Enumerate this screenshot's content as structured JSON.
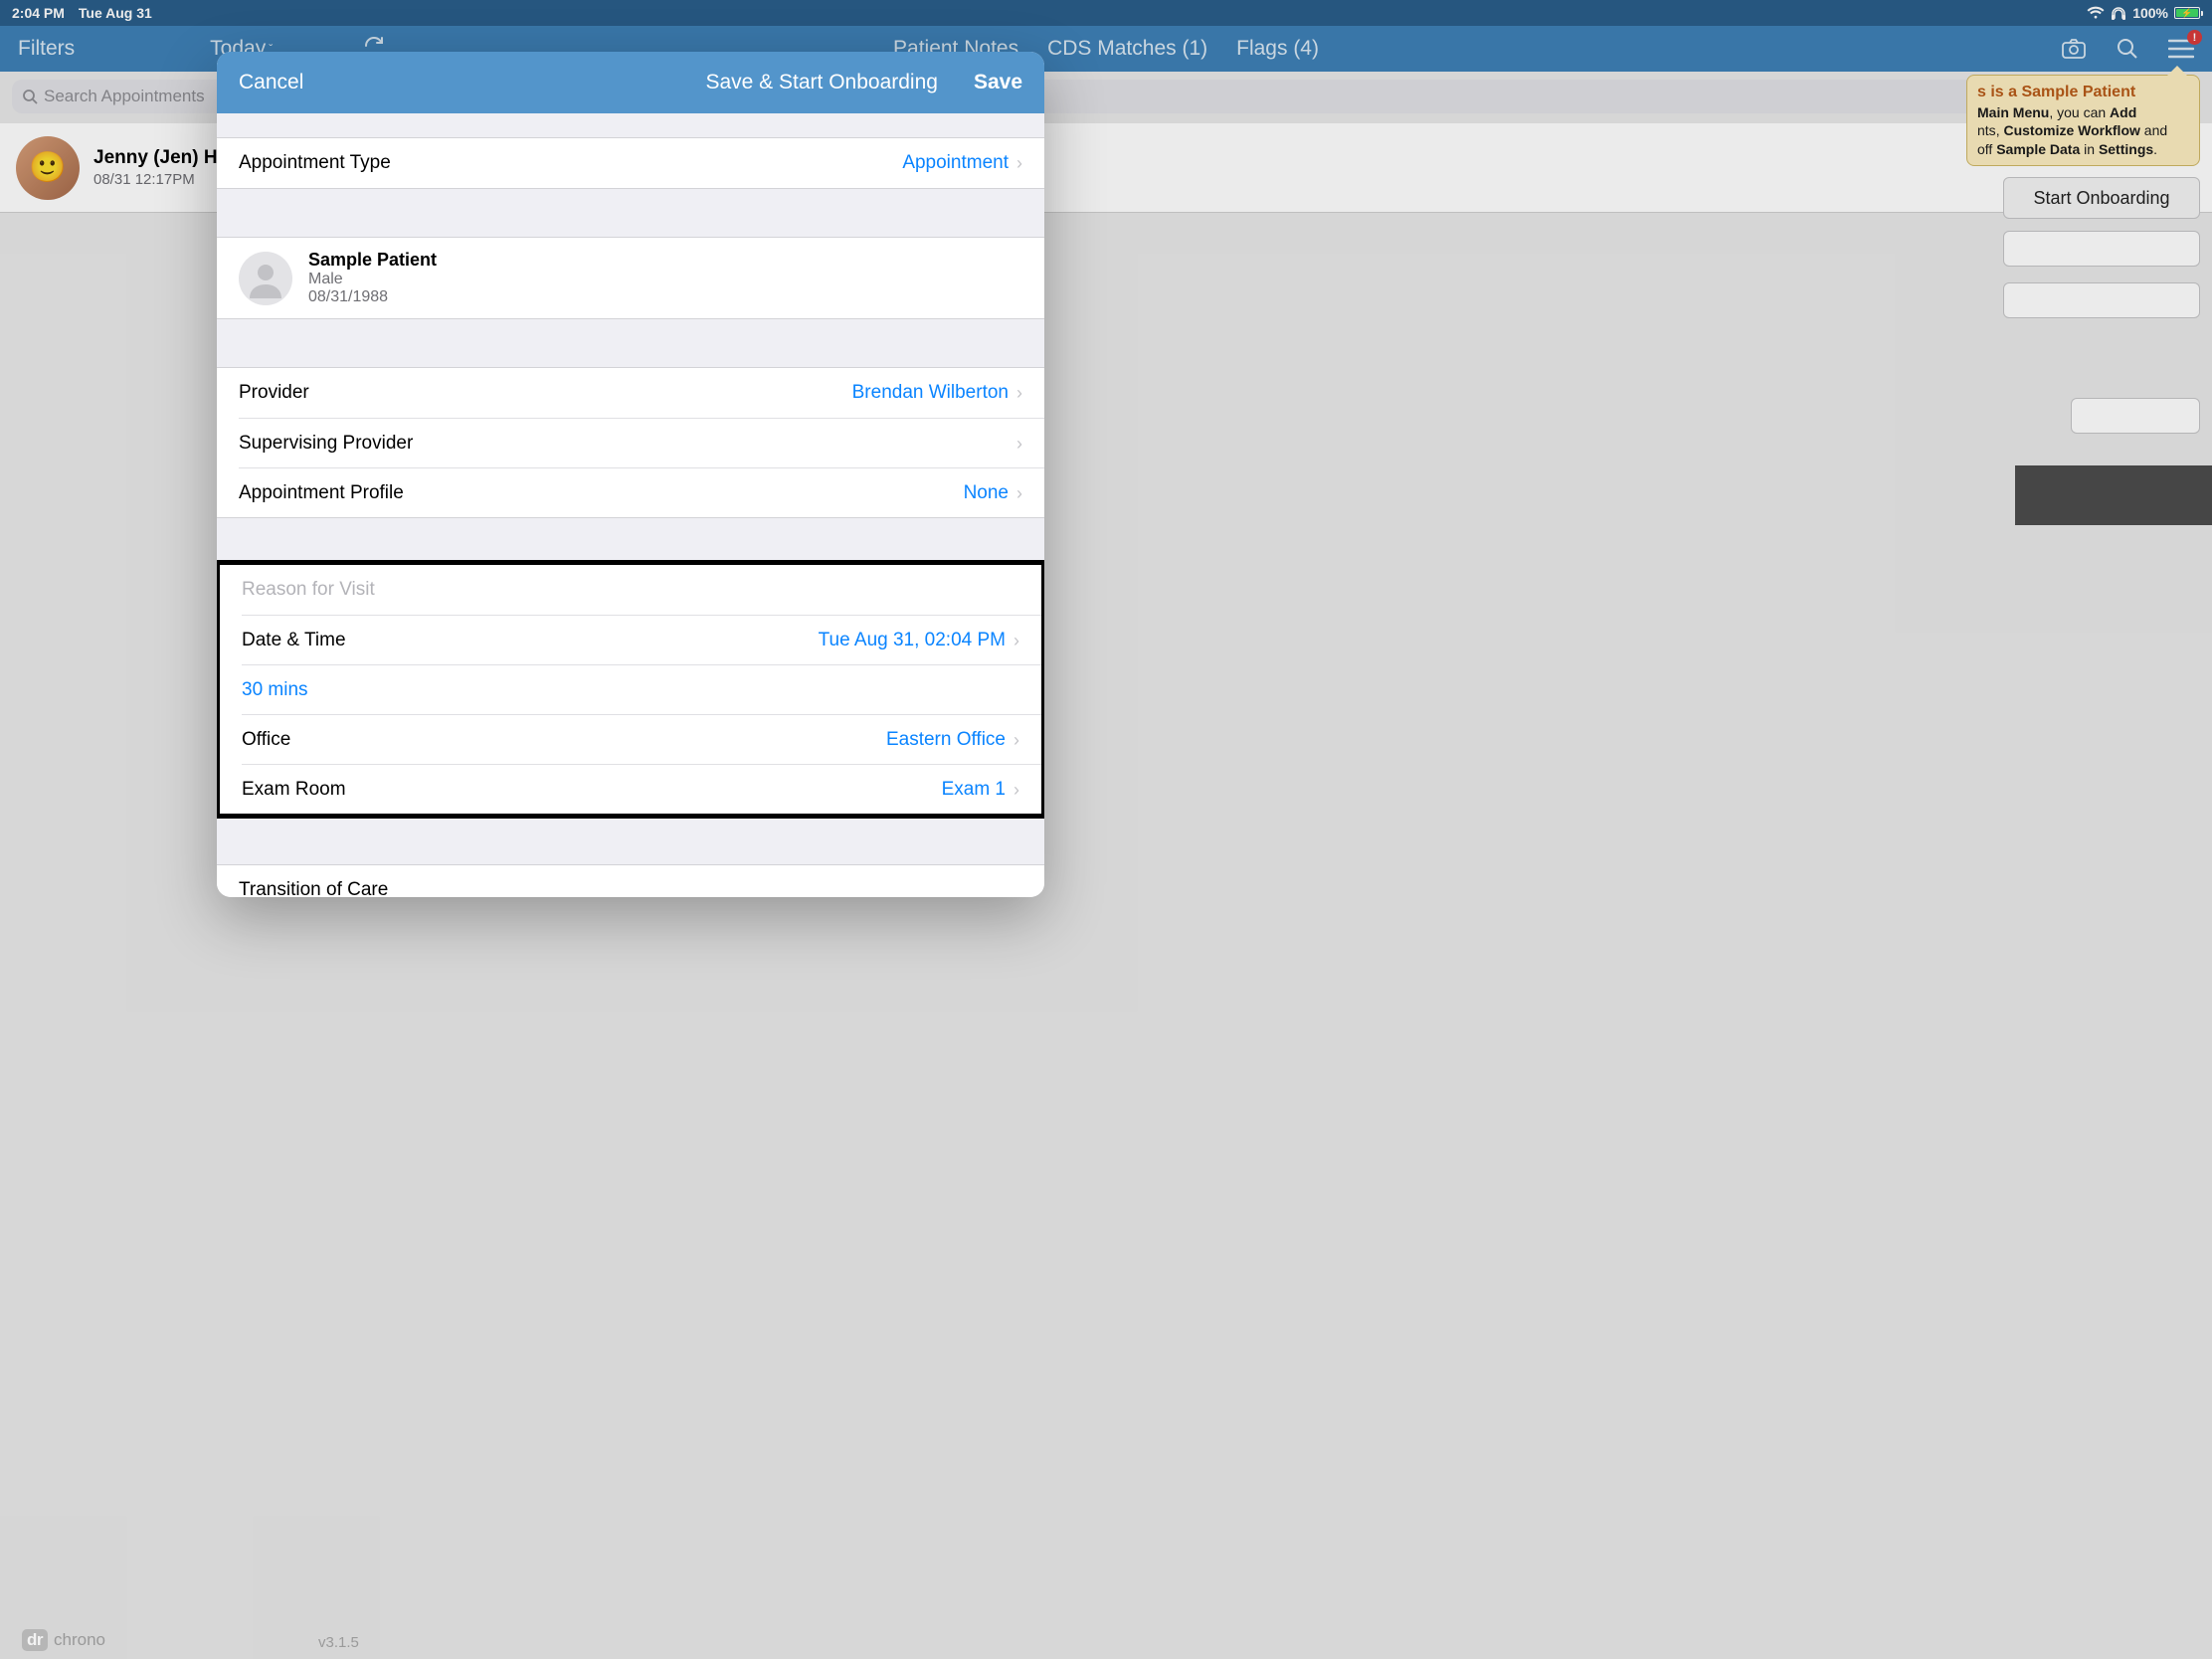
{
  "status": {
    "time": "2:04 PM",
    "date": "Tue Aug 31",
    "battery": "100%"
  },
  "nav": {
    "filters": "Filters",
    "today": "Today",
    "tab1": "Patient Notes",
    "tab2": "CDS Matches (1)",
    "tab3": "Flags (4)"
  },
  "search": {
    "placeholder": "Search Appointments"
  },
  "patient_row": {
    "name": "Jenny (Jen) Ha",
    "time": "08/31 12:17PM"
  },
  "tip": {
    "title_suffix": "s is a Sample Patient",
    "l1a": "Main Menu",
    "l1b": ", you can ",
    "l1c": "Add",
    "l2a": "nts",
    "l2b": ", ",
    "l2c": "Customize Workflow",
    "l2d": " and",
    "l3a": "off ",
    "l3b": "Sample Data",
    "l3c": " in ",
    "l3d": "Settings",
    "l3e": "."
  },
  "onboard": "Start Onboarding",
  "modal": {
    "cancel": "Cancel",
    "save_start": "Save & Start Onboarding",
    "save": "Save",
    "appt_type_label": "Appointment Type",
    "appt_type_value": "Appointment",
    "patient_name": "Sample Patient",
    "patient_gender": "Male",
    "patient_dob": "08/31/1988",
    "provider_label": "Provider",
    "provider_value": "Brendan Wilberton",
    "sup_label": "Supervising Provider",
    "profile_label": "Appointment Profile",
    "profile_value": "None",
    "reason_label": "Reason for Visit",
    "datetime_label": "Date & Time",
    "datetime_value": "Tue Aug 31, 02:04 PM",
    "duration": "30 mins",
    "office_label": "Office",
    "office_value": "Eastern Office",
    "exam_label": "Exam Room",
    "exam_value": "Exam 1",
    "transition_label": "Transition of Care"
  },
  "footer": {
    "brand_a": "dr",
    "brand_b": "chrono",
    "version": "v3.1.5"
  }
}
